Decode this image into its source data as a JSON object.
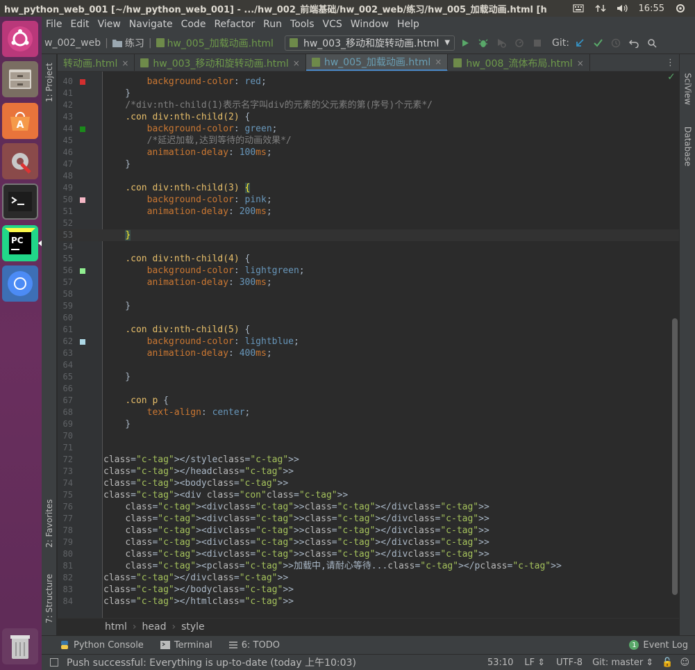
{
  "window_title": "hw_python_web_001 [~/hw_python_web_001] - .../hw_002_前端基础/hw_002_web/练习/hw_005_加载动画.html [h",
  "tray": {
    "time": "16:55"
  },
  "menu": [
    "File",
    "Edit",
    "View",
    "Navigate",
    "Code",
    "Refactor",
    "Run",
    "Tools",
    "VCS",
    "Window",
    "Help"
  ],
  "navbar": {
    "crumbs": [
      "w_002_web",
      "练习",
      "hw_005_加载动画.html"
    ],
    "run_config": "hw_003_移动和旋转动画.html",
    "git_label": "Git:"
  },
  "tabs": [
    {
      "label": "转动画.html",
      "active": false
    },
    {
      "label": "hw_003_移动和旋转动画.html",
      "active": false
    },
    {
      "label": "hw_005_加载动画.html",
      "active": true
    },
    {
      "label": "hw_008_流体布局.html",
      "active": false
    }
  ],
  "left_tools": [
    "1: Project",
    "2: Favorites",
    "7: Structure"
  ],
  "right_tools": [
    "SciView",
    "Database"
  ],
  "editor": {
    "lines": [
      {
        "n": "40",
        "text": "        background-color: red;",
        "marker": "#d32f2f"
      },
      {
        "n": "41",
        "text": "    }"
      },
      {
        "n": "42",
        "text": "    /*div:nth-child(1)表示名字叫div的元素的父元素的第(序号)个元素*/",
        "comment": true
      },
      {
        "n": "43",
        "text": "    .con div:nth-child(2) {"
      },
      {
        "n": "44",
        "text": "        background-color: green;",
        "marker": "#1b8a1b"
      },
      {
        "n": "45",
        "text": "        /*延迟加载,达到等待的动画效果*/",
        "comment": true
      },
      {
        "n": "46",
        "text": "        animation-delay: 100ms;"
      },
      {
        "n": "47",
        "text": "    }"
      },
      {
        "n": "48",
        "text": ""
      },
      {
        "n": "49",
        "text": "    .con div:nth-child(3) {"
      },
      {
        "n": "50",
        "text": "        background-color: pink;",
        "marker": "#f5b7c5"
      },
      {
        "n": "51",
        "text": "        animation-delay: 200ms;"
      },
      {
        "n": "52",
        "text": ""
      },
      {
        "n": "53",
        "text": "    }",
        "current": true
      },
      {
        "n": "54",
        "text": ""
      },
      {
        "n": "55",
        "text": "    .con div:nth-child(4) {"
      },
      {
        "n": "56",
        "text": "        background-color: lightgreen;",
        "marker": "#90ee90"
      },
      {
        "n": "57",
        "text": "        animation-delay: 300ms;"
      },
      {
        "n": "58",
        "text": ""
      },
      {
        "n": "59",
        "text": "    }"
      },
      {
        "n": "60",
        "text": ""
      },
      {
        "n": "61",
        "text": "    .con div:nth-child(5) {"
      },
      {
        "n": "62",
        "text": "        background-color: lightblue;",
        "marker": "#add8e6"
      },
      {
        "n": "63",
        "text": "        animation-delay: 400ms;"
      },
      {
        "n": "64",
        "text": ""
      },
      {
        "n": "65",
        "text": "    }"
      },
      {
        "n": "66",
        "text": ""
      },
      {
        "n": "67",
        "text": "    .con p {"
      },
      {
        "n": "68",
        "text": "        text-align: center;"
      },
      {
        "n": "69",
        "text": "    }"
      },
      {
        "n": "70",
        "text": ""
      },
      {
        "n": "71",
        "text": ""
      },
      {
        "n": "72",
        "text": "</style>"
      },
      {
        "n": "73",
        "text": "</head>"
      },
      {
        "n": "74",
        "text": "<body>"
      },
      {
        "n": "75",
        "text": "<div class=\"con\">"
      },
      {
        "n": "76",
        "text": "    <div></div>"
      },
      {
        "n": "77",
        "text": "    <div></div>"
      },
      {
        "n": "78",
        "text": "    <div></div>"
      },
      {
        "n": "79",
        "text": "    <div></div>"
      },
      {
        "n": "80",
        "text": "    <div></div>"
      },
      {
        "n": "81",
        "text": "    <p>加载中,请耐心等待...</p>"
      },
      {
        "n": "82",
        "text": "</div>"
      },
      {
        "n": "83",
        "text": "</body>"
      },
      {
        "n": "84",
        "text": "</html>"
      }
    ]
  },
  "breadcrumb": [
    "html",
    "head",
    "style"
  ],
  "tool_windows": {
    "python_console": "Python Console",
    "terminal": "Terminal",
    "todo": "6: TODO",
    "event_log": "Event Log",
    "event_log_count": "1"
  },
  "status": {
    "message": "Push successful: Everything is up-to-date (today 上午10:03)",
    "position": "53:10",
    "line_sep": "LF",
    "encoding": "UTF-8",
    "git_branch": "Git: master"
  },
  "colors": {
    "accent": "#4a88c7",
    "launcher": "#5a2a55"
  }
}
